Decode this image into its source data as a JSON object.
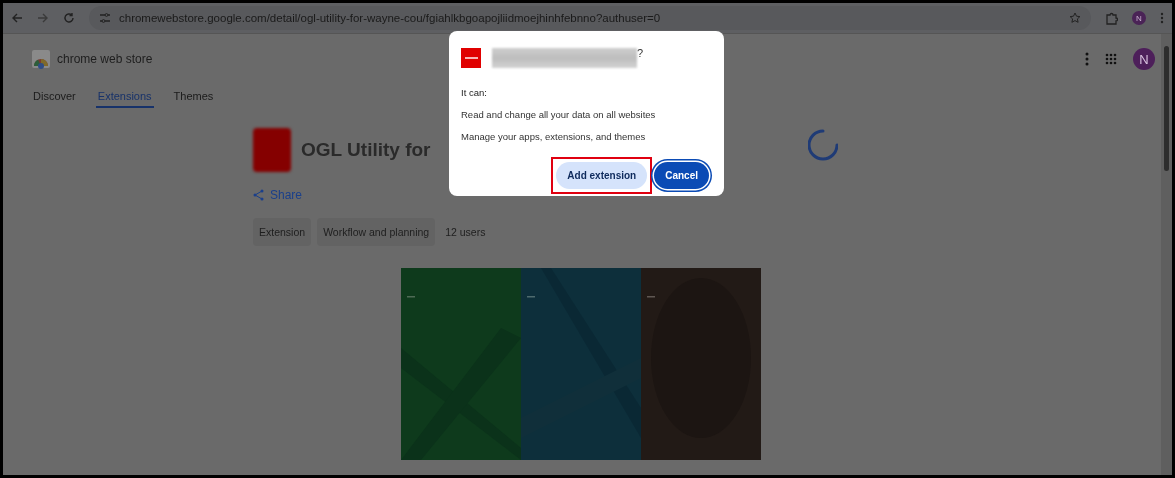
{
  "browser": {
    "url": "chromewebstore.google.com/detail/ogl-utility-for-wayne-cou/fgiahlkbgoapojliidmoejhinhfebnno?authuser=0",
    "profile_initial": "N"
  },
  "store": {
    "name": "chrome web store",
    "avatar_initial": "N",
    "tabs": [
      {
        "label": "Discover",
        "selected": false
      },
      {
        "label": "Extensions",
        "selected": true
      },
      {
        "label": "Themes",
        "selected": false
      }
    ]
  },
  "extension": {
    "title": "OGL Utility for",
    "share": "Share",
    "chips": [
      "Extension",
      "Workflow and planning"
    ],
    "users": "12 users",
    "screenshot": {
      "kind": "picture"
    }
  },
  "dialog": {
    "title_suffix": "?",
    "intro": "It can:",
    "permissions": [
      "Read and change all your data on all websites",
      "Manage your apps, extensions, and themes"
    ],
    "buttons": [
      {
        "label": "Add extension",
        "kind": "secondary",
        "highlighted": true
      },
      {
        "label": "Cancel",
        "kind": "primary",
        "highlighted": false
      }
    ]
  }
}
